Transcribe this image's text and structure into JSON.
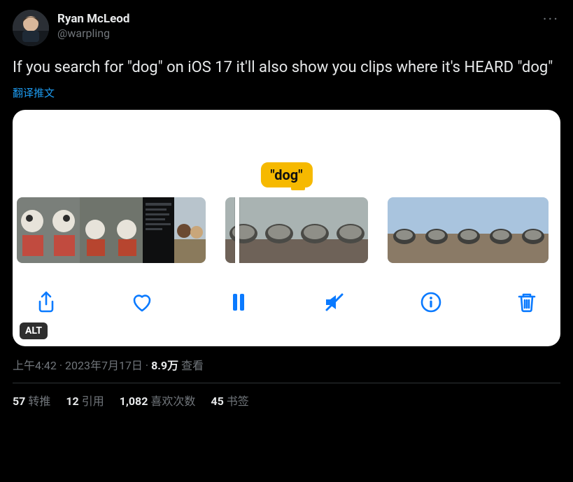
{
  "author": {
    "display_name": "Ryan McLeod",
    "handle": "@warpling"
  },
  "more_label": "···",
  "body": "If you search for \"dog\" on iOS 17 it'll also show you clips where it's HEARD \"dog\"",
  "translate_label": "翻译推文",
  "media": {
    "bubble_text": "\"dog\"",
    "alt_badge": "ALT",
    "toolbar": {
      "share": "share",
      "like": "like",
      "pause": "pause",
      "mute": "mute",
      "info": "info",
      "trash": "trash"
    }
  },
  "meta": {
    "time": "上午4:42",
    "sep1": " · ",
    "date": "2023年7月17日",
    "sep2": " · ",
    "views_count": "8.9万",
    "views_label": " 查看"
  },
  "stats": {
    "retweets_count": "57",
    "retweets_label": "转推",
    "quotes_count": "12",
    "quotes_label": "引用",
    "likes_count": "1,082",
    "likes_label": "喜欢次数",
    "bookmarks_count": "45",
    "bookmarks_label": "书签"
  }
}
